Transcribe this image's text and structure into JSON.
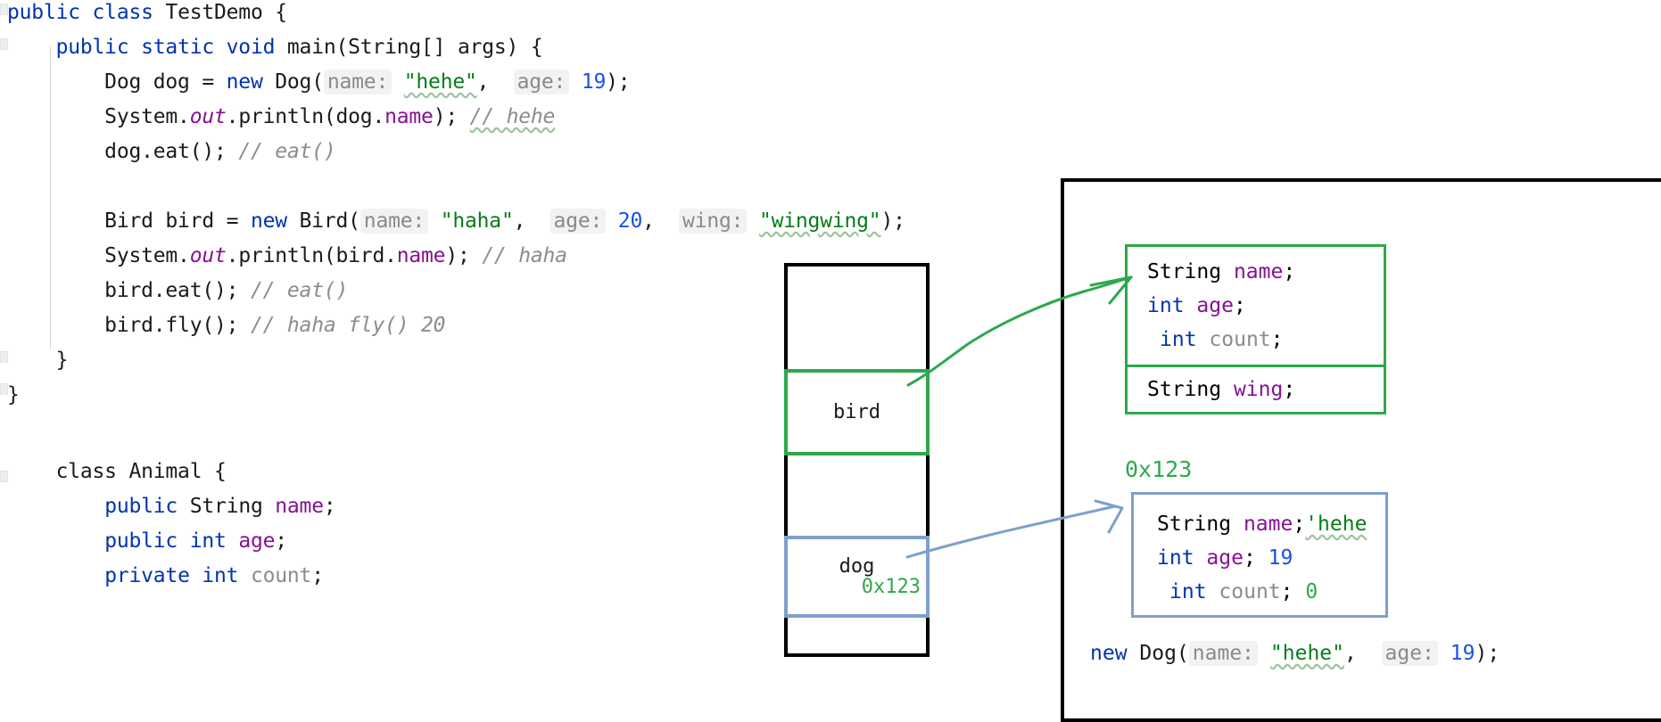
{
  "editor": {
    "lines": [
      {
        "id": "l1",
        "text": "public class TestDemo {"
      },
      {
        "id": "l2",
        "text": "    public static void main(String[] args) {"
      },
      {
        "id": "l3",
        "text": "        Dog dog = new Dog( name: \"hehe\",  age: 19);"
      },
      {
        "id": "l4",
        "text": "        System.out.println(dog.name); // hehe"
      },
      {
        "id": "l5",
        "text": "        dog.eat(); // eat()"
      },
      {
        "id": "l6",
        "text": ""
      },
      {
        "id": "l7",
        "text": "        Bird bird = new Bird( name: \"haha\",  age: 20,  wing: \"wingwing\");"
      },
      {
        "id": "l8",
        "text": "        System.out.println(bird.name); // haha"
      },
      {
        "id": "l9",
        "text": "        bird.eat(); // eat()"
      },
      {
        "id": "l10",
        "text": "        bird.fly(); // haha fly() 20"
      },
      {
        "id": "l11",
        "text": "    }"
      },
      {
        "id": "l12",
        "text": "}"
      },
      {
        "id": "l13",
        "text": ""
      },
      {
        "id": "l14",
        "text": "    class Animal {"
      },
      {
        "id": "l15",
        "text": "        public String name;"
      },
      {
        "id": "l16",
        "text": "        public int age;"
      },
      {
        "id": "l17",
        "text": "        private int count;"
      }
    ],
    "tokens": {
      "public": "public",
      "class": "class",
      "static": "static",
      "void": "void",
      "private": "private",
      "int": "int",
      "new": "new",
      "String": "String",
      "TestDemo": "TestDemo",
      "Animal": "Animal",
      "Dog": "Dog",
      "Bird": "Bird",
      "main": "main",
      "args": "String[] args",
      "name_hint": "name:",
      "age_hint": "age:",
      "wing_hint": "wing:",
      "hehe": "\"hehe\"",
      "haha": "\"haha\"",
      "wingwing": "\"wingwing\"",
      "n19": "19",
      "n20": "20",
      "comment_hehe": "// hehe",
      "comment_haha": "// haha",
      "comment_eat": "// eat()",
      "comment_fly": "// haha fly() 20",
      "field_name": "name",
      "field_age": "age",
      "field_count": "count",
      "var_dog": "dog",
      "var_bird": "bird",
      "system": "System.",
      "out": "out",
      "println": ".println(",
      "dog_name": "dog.name",
      "bird_name": "bird.name",
      "close_paren_semi": "); ",
      "dog_eat": "dog.eat(); ",
      "bird_eat": "bird.eat(); ",
      "bird_fly": "bird.fly(); "
    }
  },
  "diagram": {
    "stack": {
      "label": "stack-frame",
      "cells": [
        {
          "id": "empty-top",
          "label": "",
          "addr": "",
          "color": "#000000"
        },
        {
          "id": "bird",
          "label": "bird",
          "addr": "",
          "color": "#2ca94c"
        },
        {
          "id": "empty-middle",
          "label": "",
          "addr": "",
          "color": "#000000"
        },
        {
          "id": "dog",
          "label": "dog",
          "addr": "0x123",
          "color": "#7fa0cc"
        },
        {
          "id": "empty-bottom",
          "label": "",
          "addr": "",
          "color": "#000000"
        }
      ]
    },
    "heap": {
      "bird_object": {
        "border_color": "#2ca94c",
        "inherited_fields": [
          {
            "type": "String",
            "name": "name",
            "value": ""
          },
          {
            "type": "int",
            "name": "age",
            "value": ""
          },
          {
            "type": "int",
            "name": "count",
            "value": ""
          }
        ],
        "own_fields": [
          {
            "type": "String",
            "name": "wing",
            "value": ""
          }
        ]
      },
      "dog_object": {
        "address": "0x123",
        "border_color": "#7fa0cc",
        "fields": [
          {
            "type": "String",
            "name": "name",
            "value": "'hehe"
          },
          {
            "type": "int",
            "name": "age",
            "value": "19"
          },
          {
            "type": "int",
            "name": "count",
            "value": "0"
          }
        ],
        "caption": "new Dog( name: \"hehe\",  age: 19);"
      }
    },
    "arrows": [
      {
        "id": "bird-arrow",
        "from": "stack-cell-bird",
        "to": "heap-bird-object",
        "color": "#2ca94c"
      },
      {
        "id": "dog-arrow",
        "from": "stack-cell-dog",
        "to": "heap-dog-object",
        "color": "#7fa0cc"
      }
    ]
  },
  "colors": {
    "keyword": "#0033b3",
    "string": "#067d17",
    "number": "#1750eb",
    "field": "#871094",
    "comment": "#8c8c8c",
    "green_box": "#2ca94c",
    "blue_box": "#7fa0cc",
    "black_box": "#000000"
  }
}
